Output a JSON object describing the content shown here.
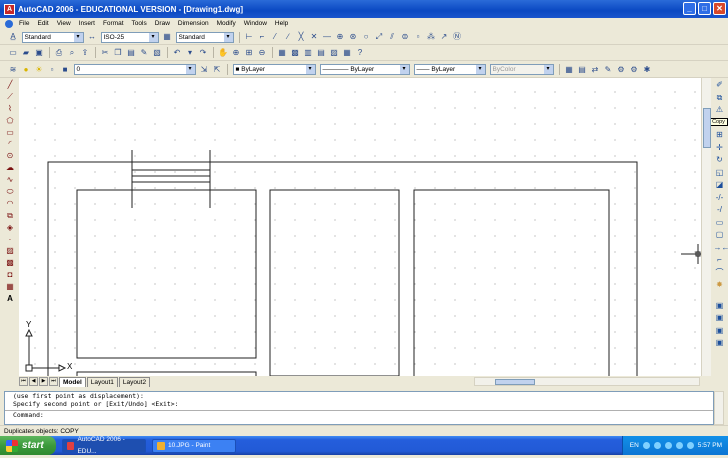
{
  "window": {
    "title": "AutoCAD 2006 - EDUCATIONAL VERSION - [Drawing1.dwg]",
    "minimize": "_",
    "maximize": "□",
    "close": "✕"
  },
  "menu": [
    "File",
    "Edit",
    "View",
    "Insert",
    "Format",
    "Tools",
    "Draw",
    "Dimension",
    "Modify",
    "Window",
    "Help"
  ],
  "styles_toolbar": {
    "text_style": "Standard",
    "dim_style": "ISO-25",
    "table_style": "Standard"
  },
  "layers_toolbar": {
    "layer": "0",
    "color": "ByLayer",
    "linetype": "ByLayer",
    "lineweight": "ByLayer",
    "plotstyle": "ByColor"
  },
  "tooltip": "Copy",
  "layout_tabs": [
    "Model",
    "Layout1",
    "Layout2"
  ],
  "ucs": {
    "x_label": "X",
    "y_label": "Y"
  },
  "command_window": {
    "lines": [
      "(use first point as displacement):",
      "Specify second point or [Exit/Undo] <Exit>:"
    ],
    "prompt": "Command:"
  },
  "status_text": "Duplicates objects:  COPY",
  "taskbar": {
    "start": "start",
    "tasks": [
      {
        "label": "AutoCAD 2006 - EDU...",
        "active": true
      },
      {
        "label": "10.JPG - Paint",
        "active": false
      }
    ],
    "language": "EN",
    "clock": "5:57 PM"
  },
  "colors": {
    "titlebar": "#0a48c2",
    "canvas_bg": "#ffffff",
    "drawing_lines": "#222222",
    "taskbar": "#245edc",
    "start": "#3c9a3c"
  }
}
